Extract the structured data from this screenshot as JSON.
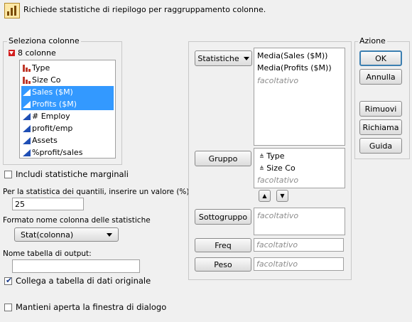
{
  "header": {
    "description": "Richiede statistiche di riepilogo per raggruppamento colonne."
  },
  "select_columns": {
    "title": "Seleziona colonne",
    "count_label": "8 colonne",
    "items": [
      {
        "label": "Type",
        "kind": "nominal",
        "selected": false
      },
      {
        "label": "Size Co",
        "kind": "nominal",
        "selected": false
      },
      {
        "label": "Sales ($M)",
        "kind": "continuous",
        "selected": true
      },
      {
        "label": "Profits ($M)",
        "kind": "continuous",
        "selected": true
      },
      {
        "label": "# Employ",
        "kind": "continuous",
        "selected": false
      },
      {
        "label": "profit/emp",
        "kind": "continuous",
        "selected": false
      },
      {
        "label": "Assets",
        "kind": "continuous",
        "selected": false
      },
      {
        "label": "%profit/sales",
        "kind": "continuous",
        "selected": false
      }
    ]
  },
  "options": {
    "marginal_label": "Includi statistiche marginali",
    "marginal_checked": false,
    "quantile_label": "Per la statistica dei quantili, inserire un valore (%)",
    "quantile_value": "25",
    "format_label": "Formato nome colonna delle statistiche",
    "format_value": "Stat(colonna)",
    "output_table_label": "Nome tabella di output:",
    "output_table_value": "",
    "link_label": "Collega a tabella di dati originale",
    "link_checked": true,
    "keep_open_label": "Mantieni aperta la finestra di dialogo",
    "keep_open_checked": false
  },
  "roles": {
    "statistics_button": "Statistiche",
    "statistics_items": [
      "Media(Sales ($M))",
      "Media(Profits ($M))"
    ],
    "optional_text": "facoltativo",
    "group_button": "Gruppo",
    "group_items": [
      "Type",
      "Size Co"
    ],
    "subgroup_button": "Sottogruppo",
    "freq_button": "Freq",
    "weight_button": "Peso"
  },
  "actions": {
    "title": "Azione",
    "ok": "OK",
    "cancel": "Annulla",
    "remove": "Rimuovi",
    "recall": "Richiama",
    "help": "Guida"
  },
  "colors": {
    "selection": "#3399ff",
    "nominal_icon": "#c0392b",
    "continuous_icon": "#1f4fb5"
  }
}
